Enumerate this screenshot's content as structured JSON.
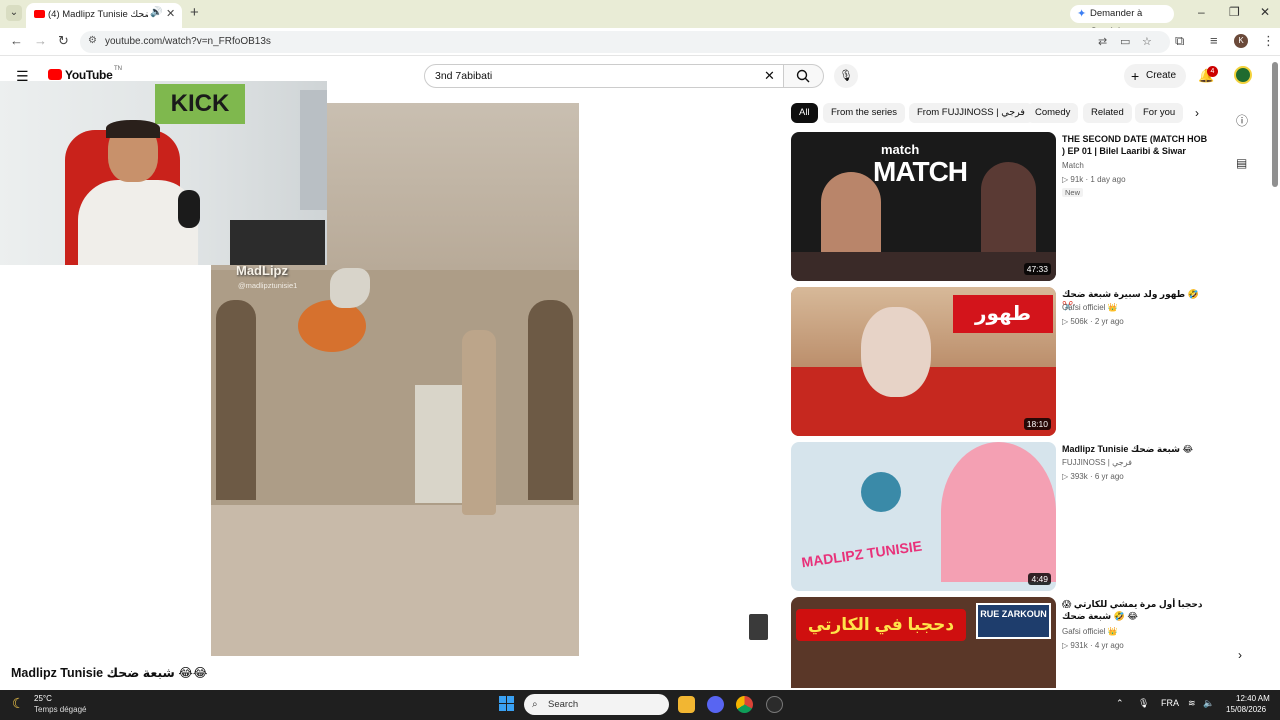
{
  "browser": {
    "tab_title": "(4) Madlipz Tunisie ضحك",
    "new_tab": "+",
    "gemini_label": "Demander à Gemini",
    "url": "youtube.com/watch?v=n_FRfoOB13s",
    "profile_initial": "K",
    "window_controls": [
      "–",
      "❐",
      "✕"
    ]
  },
  "youtube": {
    "logo_text": "YouTube",
    "logo_sup": "TN",
    "search_value": "3nd 7abibati",
    "create_label": "Create",
    "notification_count": "4"
  },
  "player": {
    "watermark": "MadLipz",
    "watermark_handle": "@madlipztunisie1",
    "webcam_sign": "KICK"
  },
  "video": {
    "title": "Madlipz Tunisie شبعة ضحك 😂😂"
  },
  "chips": [
    "All",
    "From the series",
    "From FUJJINOSS | فرجي",
    "Comedy",
    "Related",
    "For you"
  ],
  "recommendations": [
    {
      "title": "THE SECOND DATE (MATCH HOB ) EP 01 | Bilel Laaribi & Siwar",
      "channel": "Match",
      "views": "91k",
      "age": "1 day ago",
      "badge": "New",
      "duration": "47:33",
      "thumb_brand": "match",
      "thumb_text": "MATCH"
    },
    {
      "title": "طهور ولد سبيرة شبعة ضحك 🤣 ✂️",
      "channel": "Gafsi officiel 👑",
      "views": "506k",
      "age": "2 yr ago",
      "duration": "18:10",
      "thumb_text": "طهور"
    },
    {
      "title": "Madlipz Tunisie شبعة ضحك 😂",
      "channel": "FUJJINOSS | فرجي",
      "views": "393k",
      "age": "6 yr ago",
      "duration": "4:49",
      "thumb_text": "MADLIPZ TUNISIE"
    },
    {
      "title": "دحجبا أول مرة يمشي للكارتي 😱 شبعة ضحك 🤣 😂",
      "channel": "Gafsi officiel 👑",
      "views": "931k",
      "age": "4 yr ago",
      "thumb_text": "دحجبا في الكارتي",
      "thumb_street": "RUE ZARKOUN"
    }
  ],
  "taskbar": {
    "temperature": "25°C",
    "weather": "Temps dégagé",
    "search_label": "Search",
    "language": "FRA",
    "time": "12:40 AM",
    "date": "15/08/2026"
  },
  "colors": {
    "yt_red": "#ff0000",
    "chip_active_bg": "#0f0f0f",
    "tabstrip_bg": "#e9ecd6",
    "taskbar_bg": "#1f1f1f"
  }
}
